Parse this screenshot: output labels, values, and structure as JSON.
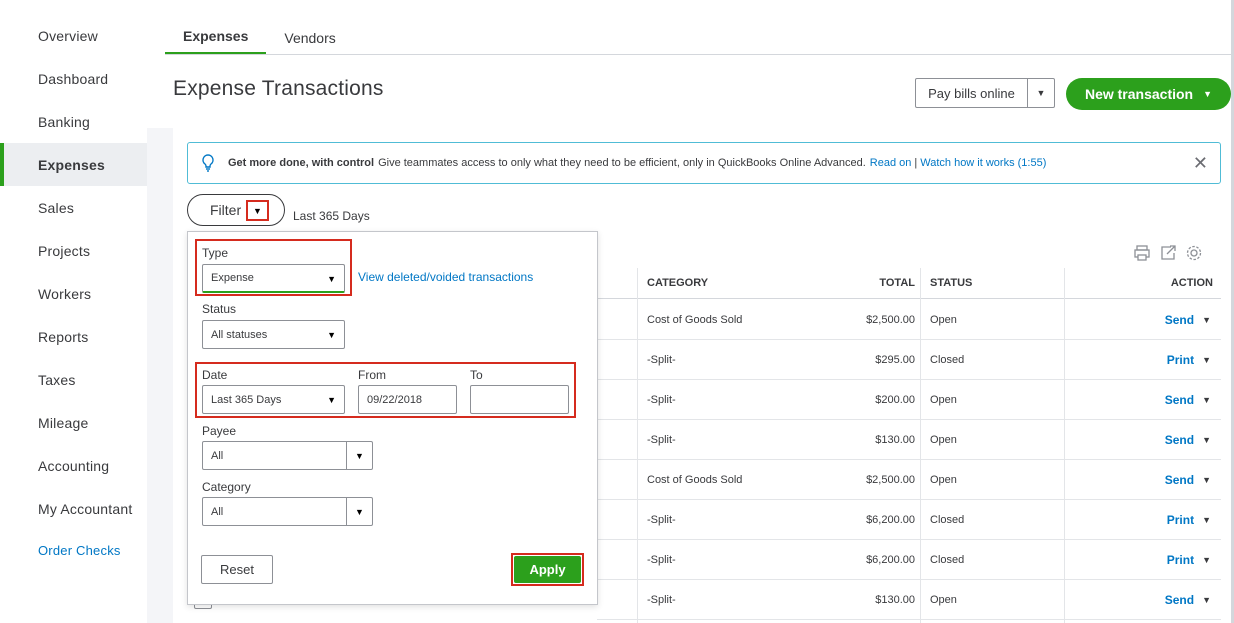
{
  "sidebar": {
    "items": [
      {
        "label": "Overview"
      },
      {
        "label": "Dashboard"
      },
      {
        "label": "Banking"
      },
      {
        "label": "Expenses"
      },
      {
        "label": "Sales"
      },
      {
        "label": "Projects"
      },
      {
        "label": "Workers"
      },
      {
        "label": "Reports"
      },
      {
        "label": "Taxes"
      },
      {
        "label": "Mileage"
      },
      {
        "label": "Accounting"
      },
      {
        "label": "My Accountant"
      }
    ],
    "order_checks": "Order Checks"
  },
  "tabs": [
    {
      "label": "Expenses"
    },
    {
      "label": "Vendors"
    }
  ],
  "page_title": "Expense Transactions",
  "header": {
    "pay_bills": "Pay bills online",
    "new_transaction": "New transaction"
  },
  "banner": {
    "bold": "Get more done, with control",
    "text": "Give teammates access to only what they need to be efficient, only in QuickBooks Online Advanced.",
    "read_on": "Read on",
    "separator": "|",
    "watch": "Watch how it works (1:55)",
    "close": "✕"
  },
  "filter": {
    "button": "Filter",
    "range": "Last 365 Days",
    "type_label": "Type",
    "type_value": "Expense",
    "view_deleted": "View deleted/voided transactions",
    "status_label": "Status",
    "status_value": "All statuses",
    "date_label": "Date",
    "date_value": "Last 365 Days",
    "from_label": "From",
    "from_value": "09/22/2018",
    "to_label": "To",
    "to_value": "",
    "payee_label": "Payee",
    "payee_value": "All",
    "category_label": "Category",
    "category_value": "All",
    "reset": "Reset",
    "apply": "Apply"
  },
  "table": {
    "headers": {
      "category": "CATEGORY",
      "total": "TOTAL",
      "status": "STATUS",
      "action": "ACTION"
    },
    "rows": [
      {
        "category": "Cost of Goods Sold",
        "total": "$2,500.00",
        "status": "Open",
        "action": "Send"
      },
      {
        "category": "-Split-",
        "total": "$295.00",
        "status": "Closed",
        "action": "Print"
      },
      {
        "category": "-Split-",
        "total": "$200.00",
        "status": "Open",
        "action": "Send"
      },
      {
        "category": "-Split-",
        "total": "$130.00",
        "status": "Open",
        "action": "Send"
      },
      {
        "category": "Cost of Goods Sold",
        "total": "$2,500.00",
        "status": "Open",
        "action": "Send"
      },
      {
        "category": "-Split-",
        "total": "$6,200.00",
        "status": "Closed",
        "action": "Print"
      },
      {
        "category": "-Split-",
        "total": "$6,200.00",
        "status": "Closed",
        "action": "Print"
      },
      {
        "category": "-Split-",
        "total": "$130.00",
        "status": "Open",
        "action": "Send"
      }
    ]
  },
  "colors": {
    "accent_green": "#2ca01c",
    "link_blue": "#0077c5",
    "highlight_red": "#d52b1e"
  }
}
